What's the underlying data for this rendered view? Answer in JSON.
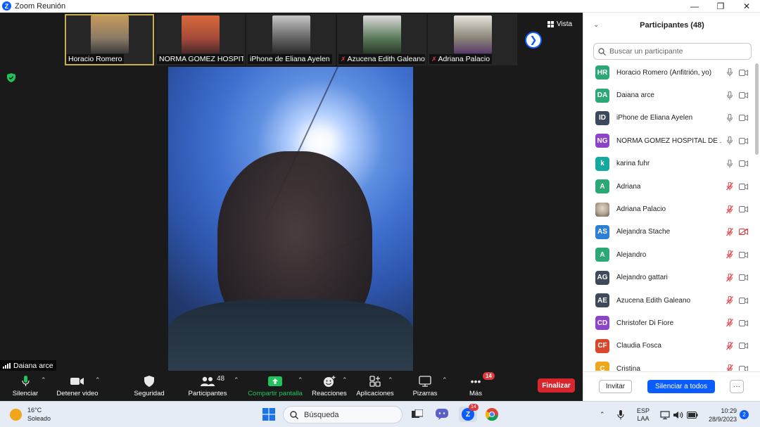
{
  "window": {
    "title": "Zoom Reunión"
  },
  "gallery": {
    "thumbnails": [
      {
        "name": "Horacio Romero",
        "muted": false,
        "active": true,
        "color": "#8a7a66"
      },
      {
        "name": "NORMA GOMEZ HOSPIT...",
        "muted": false,
        "active": false,
        "color": "#a54a3a"
      },
      {
        "name": "iPhone de Eliana Ayelen",
        "muted": false,
        "active": false,
        "color": "#6b6b6b"
      },
      {
        "name": "Azucena Edith Galeano",
        "muted": true,
        "active": false,
        "color": "#5a7a5a"
      },
      {
        "name": "Adriana Palacio",
        "muted": true,
        "active": false,
        "color": "#8a8478"
      }
    ],
    "view_label": "Vista"
  },
  "speaker": {
    "name": "Daiana arce"
  },
  "toolbar": {
    "mute_label": "Silenciar",
    "video_label": "Detener video",
    "security_label": "Seguridad",
    "participants_label": "Participantes",
    "participants_count": "48",
    "share_label": "Compartir pantalla",
    "reactions_label": "Reacciones",
    "apps_label": "Aplicaciones",
    "whiteboards_label": "Pizarras",
    "more_label": "Más",
    "more_badge": "14",
    "end_label": "Finalizar"
  },
  "panel": {
    "title": "Participantes (48)",
    "search_placeholder": "Buscar un participante",
    "participants": [
      {
        "initials": "HR",
        "name": "Horacio Romero (Anfitrión, yo)",
        "color": "#2aa876",
        "mic_muted": false,
        "cam_off": false
      },
      {
        "initials": "DA",
        "name": "Daiana arce",
        "color": "#2aa876",
        "mic_muted": false,
        "cam_off": false
      },
      {
        "initials": "ID",
        "name": "iPhone de Eliana Ayelen",
        "color": "#3d4a5c",
        "mic_muted": false,
        "cam_off": false
      },
      {
        "initials": "NG",
        "name": "NORMA GOMEZ HOSPITAL DE ...",
        "color": "#8e44c9",
        "mic_muted": false,
        "cam_off": false
      },
      {
        "initials": "k",
        "name": "karina fuhr",
        "color": "#13a8a0",
        "mic_muted": false,
        "cam_off": false
      },
      {
        "initials": "A",
        "name": "Adriana",
        "color": "#2aa876",
        "mic_muted": true,
        "cam_off": false
      },
      {
        "initials": "",
        "name": "Adriana Palacio",
        "color": "#b8a89a",
        "mic_muted": true,
        "cam_off": false,
        "photo": true
      },
      {
        "initials": "AS",
        "name": "Alejandra Stache",
        "color": "#2d7fd3",
        "mic_muted": true,
        "cam_off": true
      },
      {
        "initials": "A",
        "name": "Alejandro",
        "color": "#2aa876",
        "mic_muted": true,
        "cam_off": false
      },
      {
        "initials": "AG",
        "name": "Alejandro gattari",
        "color": "#3d4a5c",
        "mic_muted": true,
        "cam_off": false
      },
      {
        "initials": "AE",
        "name": "Azucena Edith Galeano",
        "color": "#3d4a5c",
        "mic_muted": true,
        "cam_off": false
      },
      {
        "initials": "CD",
        "name": "Christofer Di Fiore",
        "color": "#8e44c9",
        "mic_muted": true,
        "cam_off": false
      },
      {
        "initials": "CF",
        "name": "Claudia Fosca",
        "color": "#d9462c",
        "mic_muted": true,
        "cam_off": false
      },
      {
        "initials": "C",
        "name": "Cristina",
        "color": "#f0a81a",
        "mic_muted": true,
        "cam_off": false
      }
    ],
    "invite_label": "Invitar",
    "mute_all_label": "Silenciar a todos",
    "more_label": "···"
  },
  "taskbar": {
    "temperature": "16°C",
    "weather": "Soleado",
    "search_label": "Búsqueda",
    "zoom_badge": "14",
    "lang": "ESP",
    "layout": "LAA",
    "time": "10:29",
    "date": "28/9/2023",
    "notifications": "2"
  },
  "colors": {
    "accent": "#0b5cff",
    "end": "#d9262c",
    "muted": "#e0393e",
    "share": "#21c35c"
  }
}
